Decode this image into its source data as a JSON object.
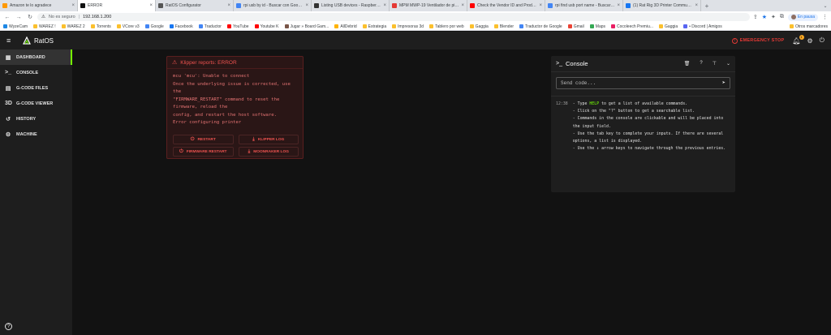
{
  "browser": {
    "tabs": [
      {
        "label": "Amazon te lo agradece",
        "color": "#ff9900"
      },
      {
        "label": "ERROR",
        "color": "#111111",
        "active": true
      },
      {
        "label": "RatOS Configurator",
        "color": "#555555"
      },
      {
        "label": "rpi usb by id - Buscar con Googl...",
        "color": "#4285f4"
      },
      {
        "label": "Listing USB devices - Raspberry P...",
        "color": "#333333"
      },
      {
        "label": "MPM MWP-19 Ventilador de pie...",
        "color": "#e53935"
      },
      {
        "label": "Check the Vendor ID and Produ...",
        "color": "#ff0000"
      },
      {
        "label": "rpi find usb port name - Buscar c...",
        "color": "#4285f4"
      },
      {
        "label": "(1) Rat Rig 3D Printer Communi...",
        "color": "#1877f2"
      }
    ],
    "new_tab": "+",
    "tab_menu": "⌄",
    "address": {
      "insecure_label": "No es seguro",
      "url": "192.168.1.200"
    },
    "profile_label": "En pausa",
    "bookmarks": [
      {
        "label": "WyzeCam",
        "color": "#1e88e5"
      },
      {
        "label": "WAREZ !",
        "color": "#fbc02d"
      },
      {
        "label": "WAREZ 2",
        "color": "#fbc02d"
      },
      {
        "label": "Torrents",
        "color": "#fbc02d"
      },
      {
        "label": "VCore v3",
        "color": "#fbc02d"
      },
      {
        "label": "Google",
        "color": "#4285f4"
      },
      {
        "label": "Facebook",
        "color": "#1877f2"
      },
      {
        "label": "Traductor",
        "color": "#4285f4"
      },
      {
        "label": "YouTube",
        "color": "#ff0000"
      },
      {
        "label": "Youtube K",
        "color": "#ff0000"
      },
      {
        "label": "Jugar » Board Gam...",
        "color": "#795548"
      },
      {
        "label": "AllDebrid",
        "color": "#ffb300"
      },
      {
        "label": "Estrategia",
        "color": "#fbc02d"
      },
      {
        "label": "Impresoras 3d",
        "color": "#fbc02d"
      },
      {
        "label": "Tablero por web",
        "color": "#fbc02d"
      },
      {
        "label": "Gaggia",
        "color": "#fbc02d"
      },
      {
        "label": "Blender",
        "color": "#fbc02d"
      },
      {
        "label": "Traductor de Google",
        "color": "#4285f4"
      },
      {
        "label": "Gmail",
        "color": "#ea4335"
      },
      {
        "label": "Maps",
        "color": "#34a853"
      },
      {
        "label": "Cocoleech Premiu...",
        "color": "#e91e63"
      },
      {
        "label": "Gaggia",
        "color": "#fbc02d"
      },
      {
        "label": "• Discord | Amigos",
        "color": "#5865f2"
      }
    ],
    "other_bookmarks": "Otros marcadores"
  },
  "app": {
    "brand": "RatOS",
    "emergency_stop": "EMERGENCY STOP",
    "notification_count": "1"
  },
  "sidebar": {
    "items": [
      {
        "label": "DASHBOARD",
        "icon": "▦",
        "active": true
      },
      {
        "label": "CONSOLE",
        "icon": ">_"
      },
      {
        "label": "G-CODE FILES",
        "icon": "▤"
      },
      {
        "label": "G-CODE VIEWER",
        "icon": "3D"
      },
      {
        "label": "HISTORY",
        "icon": "↺"
      },
      {
        "label": "MACHINE",
        "icon": "⚙"
      }
    ],
    "help": "?"
  },
  "error_card": {
    "title": "Klipper reports: ERROR",
    "lines": [
      "mcu 'mcu': Unable to connect",
      "Once the underlying issue is corrected, use",
      "the",
      "\"FIRMWARE_RESTART\" command to reset the",
      "firmware, reload the",
      "config, and restart the host software.",
      "Error configuring printer"
    ],
    "buttons": {
      "restart": "RESTART",
      "klipper_log": "KLIPPER LOG",
      "firmware_restart": "FIRMWARE RESTART",
      "moonraker_log": "MOONRAKER LOG"
    }
  },
  "console": {
    "title": "Console",
    "input_placeholder": "Send code...",
    "time": "12:38",
    "line1_pre": "- Type ",
    "line1_help": "HELP",
    "line1_post": " to get a list of available commands.",
    "lines": [
      "- Click on the \"?\" button to get a searchable list.",
      "- Commands in the console are clickable and will be placed into",
      "the input field.",
      "- Use the tab key to complete your inputs. If there are several",
      "options, a list is displayed.",
      "- Use the ⇕ arrow keys to navigate through the previous entries."
    ]
  }
}
